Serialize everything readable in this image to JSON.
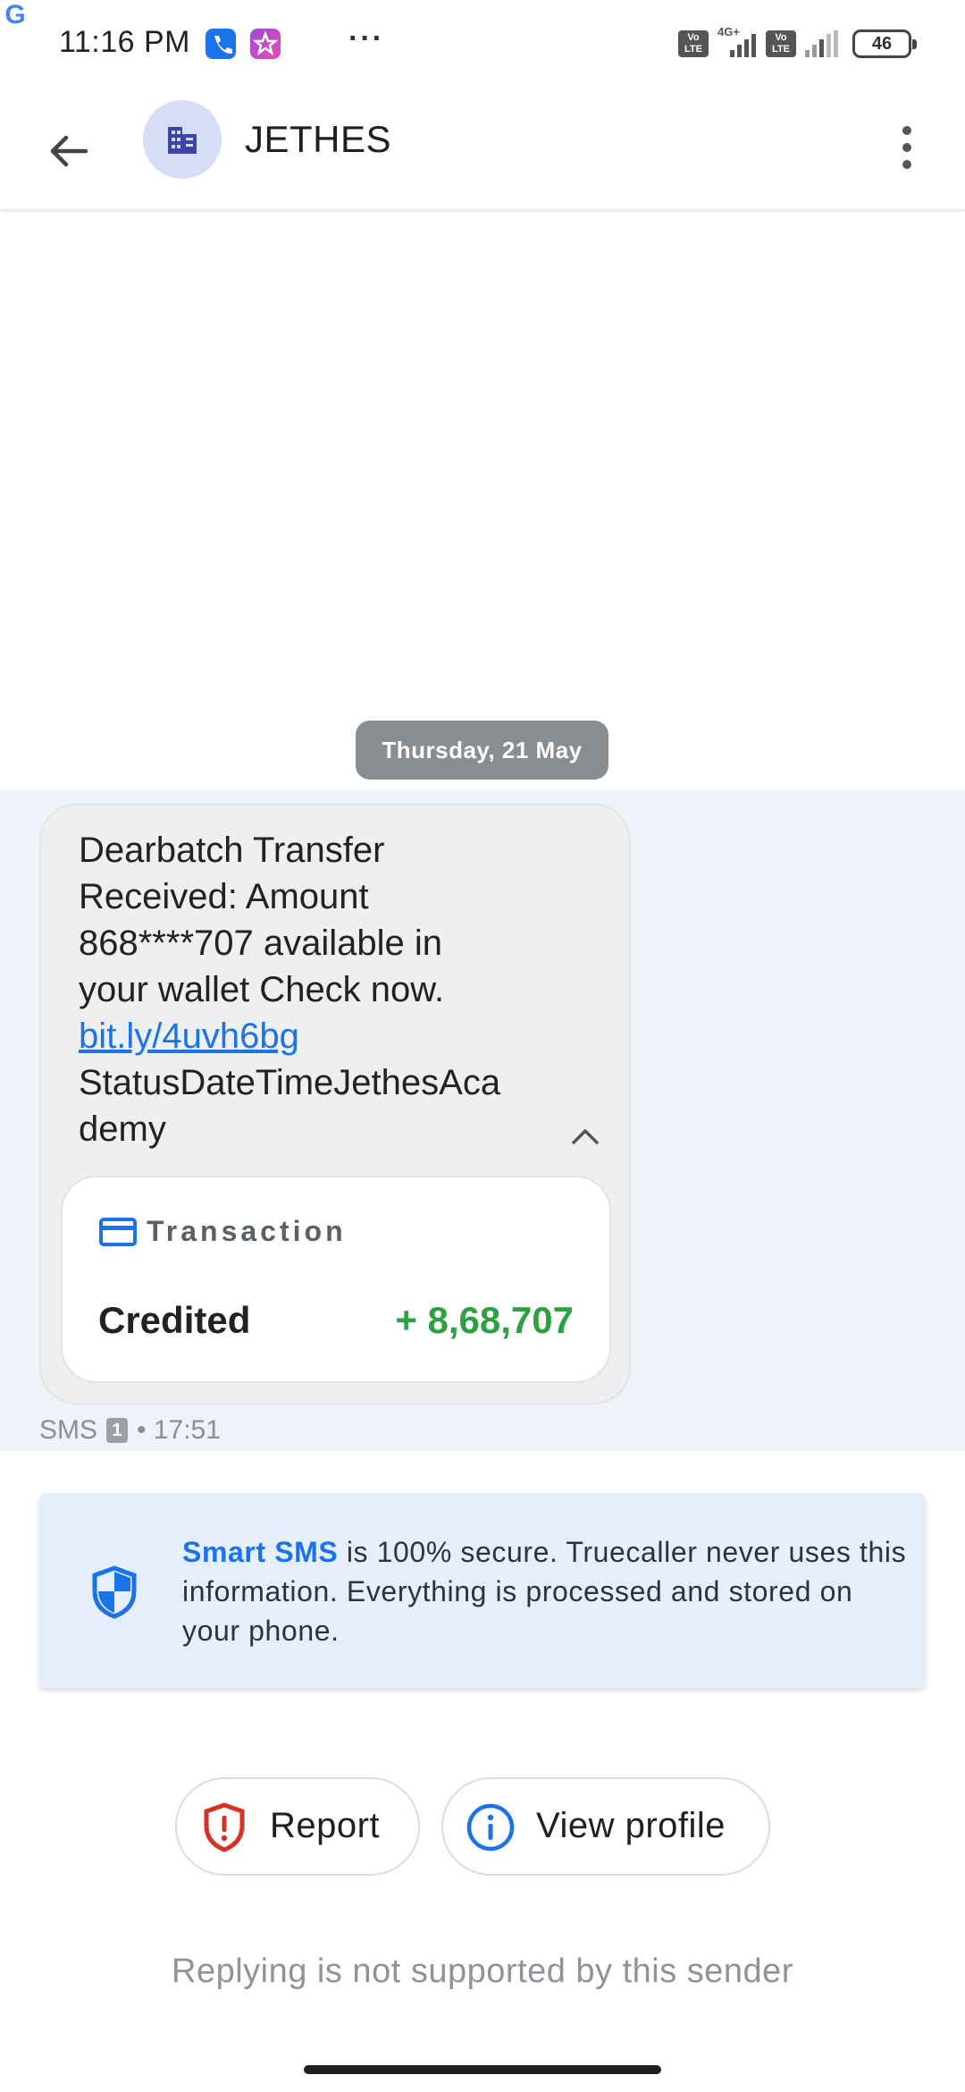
{
  "status_bar": {
    "time": "11:16 PM",
    "dots": "···",
    "network_label": "4G+",
    "volte_label": "Vo LTE",
    "battery": "46"
  },
  "app_bar": {
    "contact_name": "JETHES",
    "avatar_icon": "building-icon"
  },
  "conversation": {
    "date_chip": "Thursday, 21 May",
    "message": {
      "lines": [
        "Dearbatch Transfer",
        "Received:  Amount",
        "868****707 available in",
        "your wallet Check now."
      ],
      "link": "bit.ly/4uvh6bg",
      "tail_lines": [
        "StatusDateTimeJethesAca",
        "demy"
      ],
      "transaction": {
        "title": "Transaction",
        "label": "Credited",
        "amount": "+ 8,68,707"
      },
      "meta_type": "SMS",
      "sim": "1",
      "time": "• 17:51"
    }
  },
  "secure_notice": {
    "strong": "Smart SMS",
    "text": " is 100% secure. Truecaller never uses this information. Everything is processed and stored on your phone."
  },
  "actions": {
    "report_label": "Report",
    "profile_label": "View profile"
  },
  "reply_note": "Replying is not supported by this sender",
  "colors": {
    "accent": "#1a73e8",
    "credit_green": "#2ea043",
    "report_red": "#d93025",
    "avatar_bg": "#d7dcf7"
  }
}
